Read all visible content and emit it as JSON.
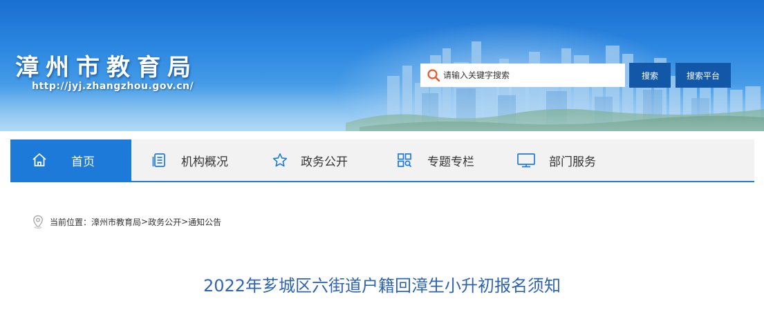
{
  "header": {
    "site_title": "漳州市教育局",
    "site_url": "http://jyj.zhangzhou.gov.cn/",
    "search": {
      "placeholder": "请输入关键字搜索",
      "value": "",
      "search_label": "搜索",
      "platform_label": "搜索平台"
    }
  },
  "nav": {
    "items": [
      {
        "label": "首页",
        "icon": "home-icon",
        "active": true
      },
      {
        "label": "机构概况",
        "icon": "document-list-icon",
        "active": false
      },
      {
        "label": "政务公开",
        "icon": "star-icon",
        "active": false
      },
      {
        "label": "专题专栏",
        "icon": "grid-search-icon",
        "active": false
      },
      {
        "label": "部门服务",
        "icon": "monitor-icon",
        "active": false
      }
    ]
  },
  "breadcrumb": {
    "prefix": "当前位置：",
    "items": [
      "漳州市教育局",
      "政务公开",
      "通知公告"
    ],
    "separator": ">"
  },
  "article": {
    "title": "2022年芗城区六街道户籍回漳生小升初报名须知"
  },
  "colors": {
    "accent": "#1e7ad8",
    "button": "#1257a8",
    "title": "#2e64b2",
    "nav_bg": "#f2f2f2"
  }
}
